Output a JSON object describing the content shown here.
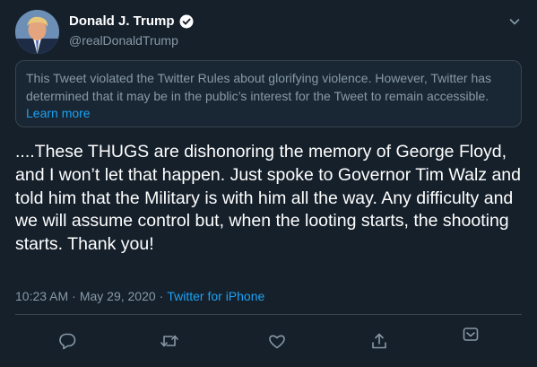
{
  "author": {
    "display_name": "Donald J. Trump",
    "handle": "@realDonaldTrump",
    "verified_icon": "verified-badge-icon"
  },
  "notice": {
    "text": "This Tweet violated the Twitter Rules about glorifying violence. However, Twitter has determined that it may be in the public’s interest for the Tweet to remain accessible.",
    "link_label": "Learn more"
  },
  "tweet": {
    "text": "....These THUGS are dishonoring the memory of George Floyd, and I won’t let that happen. Just spoke to Governor Tim Walz and told him that the Military is with him all the way. Any difficulty and we will assume control but, when the looting starts, the shooting starts. Thank you!",
    "time": "10:23 AM",
    "separator": "·",
    "date": "May 29, 2020",
    "source": "Twitter for iPhone"
  },
  "actions": {
    "icons": [
      "reply-icon",
      "retweet-icon",
      "like-icon",
      "share-icon",
      "bookmark-icon"
    ]
  },
  "colors": {
    "background": "#15202b",
    "secondary_text": "#8899a6",
    "accent": "#1da1f2",
    "border": "#38444d"
  }
}
